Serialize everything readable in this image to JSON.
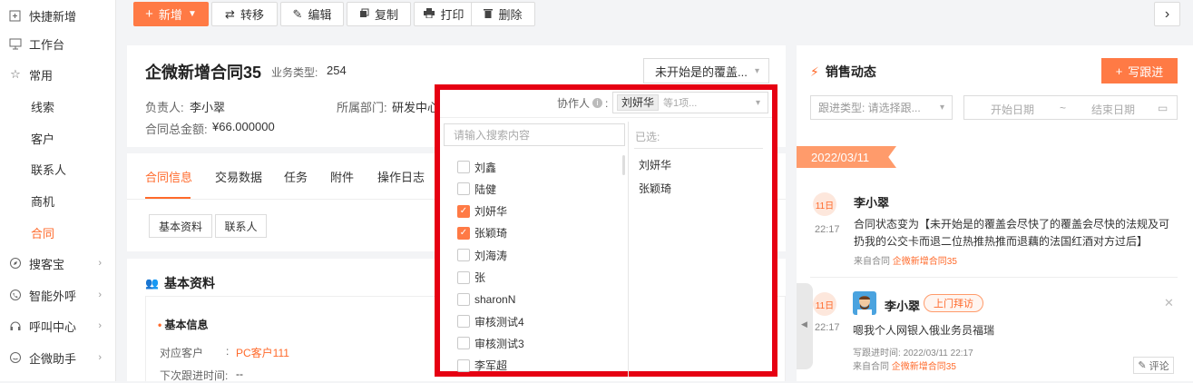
{
  "sidebar": {
    "items": [
      {
        "label": "快捷新增"
      },
      {
        "label": "工作台"
      },
      {
        "label": "常用"
      },
      {
        "label": "线索"
      },
      {
        "label": "客户"
      },
      {
        "label": "联系人"
      },
      {
        "label": "商机"
      },
      {
        "label": "合同"
      },
      {
        "label": "搜客宝"
      },
      {
        "label": "智能外呼"
      },
      {
        "label": "呼叫中心"
      },
      {
        "label": "企微助手"
      }
    ]
  },
  "toolbar": {
    "new": "新增",
    "transfer": "转移",
    "edit": "编辑",
    "copy": "复制",
    "print": "打印",
    "delete": "删除"
  },
  "contract": {
    "title": "企微新增合同35",
    "biz_type_label": "业务类型:",
    "biz_type_value": "254",
    "status_select": "未开始是的覆盖...",
    "owner_label": "负责人:",
    "owner_value": "李小翠",
    "dept_label": "所属部门:",
    "dept_value": "研发中心",
    "amount_label": "合同总金额:",
    "amount_value": "¥66.000000"
  },
  "tabs": [
    "合同信息",
    "交易数据",
    "任务",
    "附件",
    "操作日志"
  ],
  "subtabs": [
    "基本资料",
    "联系人"
  ],
  "basic": {
    "section_title": "基本资料",
    "group_title": "基本信息",
    "customer_label": "对应客户",
    "customer_value": "PC客户111",
    "next_follow_label": "下次跟进时间:",
    "next_follow_value": "--"
  },
  "collab": {
    "label": "协作人",
    "selected_tag": "刘妍华",
    "more_text": "等1项...",
    "search_placeholder": "请输入搜索内容",
    "selected_header": "已选:",
    "options": [
      {
        "name": "刘鑫",
        "checked": false
      },
      {
        "name": "陆健",
        "checked": false
      },
      {
        "name": "刘妍华",
        "checked": true
      },
      {
        "name": "张颖琦",
        "checked": true
      },
      {
        "name": "刘海涛",
        "checked": false
      },
      {
        "name": "张",
        "checked": false
      },
      {
        "name": "sharonN",
        "checked": false
      },
      {
        "name": "审核测试4",
        "checked": false
      },
      {
        "name": "审核测试3",
        "checked": false
      },
      {
        "name": "李军超",
        "checked": false
      }
    ],
    "selected": [
      "刘妍华",
      "张颖琦"
    ],
    "colors": {
      "accent": "#ff7a45",
      "highlight_border": "#e60012"
    }
  },
  "sales": {
    "title": "销售动态",
    "write_button": "写跟进",
    "filter_placeholder": "跟进类型: 请选择跟...",
    "start_date": "开始日期",
    "date_sep": "~",
    "end_date": "结束日期",
    "date_banner": "2022/03/11",
    "entries": [
      {
        "day": "11日",
        "time": "22:17",
        "author": "李小翠",
        "text": "合同状态变为【未开始是的覆盖会尽快了的覆盖会尽快的法规及可扔我的公交卡而退二位热推热推而退藕的法国红酒对方过后】",
        "source_label": "来自合同",
        "source_link": "企微新增合同35"
      },
      {
        "day": "11日",
        "time": "22:17",
        "author": "李小翠",
        "badge": "上门拜访",
        "text": "嗯我个人网银入俄业务员福瑞",
        "follow_time_label": "写跟进时间:",
        "follow_time": "2022/03/11 22:17",
        "source_label": "来自合同",
        "source_link": "企微新增合同35",
        "comment": "评论"
      }
    ]
  }
}
